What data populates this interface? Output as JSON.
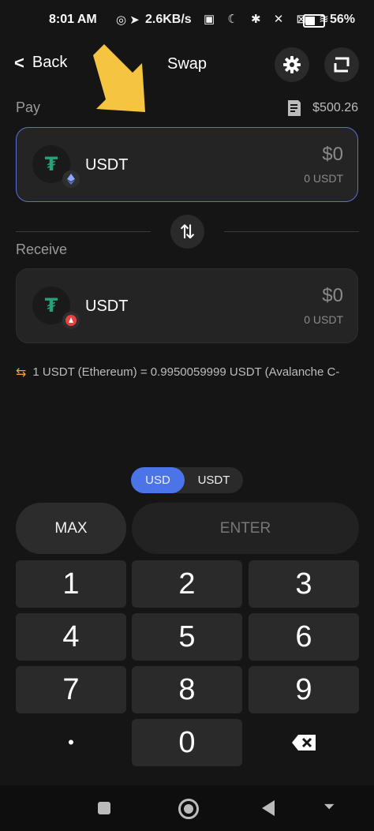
{
  "status_bar": {
    "time": "8:01 AM",
    "speed": "2.6KB/s",
    "battery": "56%"
  },
  "header": {
    "back_label": "Back",
    "title": "Swap",
    "settings_icon": "gear-icon",
    "history_icon": "history-icon"
  },
  "pay": {
    "label": "Pay",
    "balance": "$500.26",
    "token": "USDT",
    "usd_value": "$0",
    "token_value": "0 USDT",
    "chain_icon": "ethereum-icon"
  },
  "receive": {
    "label": "Receive",
    "token": "USDT",
    "usd_value": "$0",
    "token_value": "0 USDT",
    "chain_icon": "avalanche-icon"
  },
  "rate_text": "1 USDT (Ethereum) = 0.9950059999 USDT (Avalanche C-",
  "currency_toggle": {
    "options": [
      "USD",
      "USDT"
    ],
    "selected": "USD"
  },
  "actions": {
    "max_label": "MAX",
    "enter_label": "ENTER"
  },
  "keypad": [
    "1",
    "2",
    "3",
    "4",
    "5",
    "6",
    "7",
    "8",
    "9",
    "•",
    "0",
    "⌫"
  ],
  "colors": {
    "accent": "#4a74e8",
    "tether": "#26a17b",
    "arrow": "#f5c542",
    "avalanche": "#e84142"
  }
}
